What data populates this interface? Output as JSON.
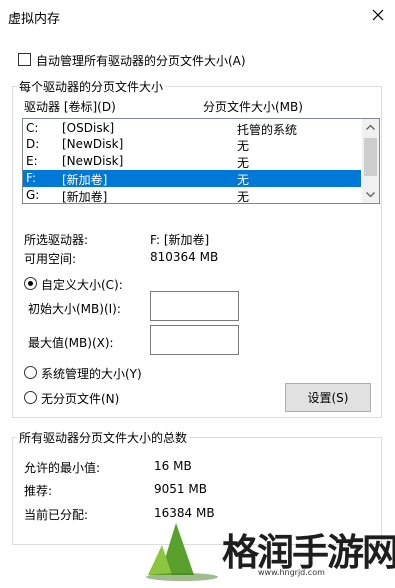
{
  "window": {
    "title": "虚拟内存"
  },
  "auto_manage": {
    "label": "自动管理所有驱动器的分页文件大小(A)",
    "checked": false
  },
  "per_drive": {
    "group_title": "每个驱动器的分页文件大小",
    "col_drive": "驱动器 [卷标](D)",
    "col_size": "分页文件大小(MB)",
    "drives": [
      {
        "letter": "C:",
        "label": "[OSDisk]",
        "size": "托管的系统",
        "selected": false
      },
      {
        "letter": "D:",
        "label": "[NewDisk]",
        "size": "无",
        "selected": false
      },
      {
        "letter": "E:",
        "label": "[NewDisk]",
        "size": "无",
        "selected": false
      },
      {
        "letter": "F:",
        "label": "[新加卷]",
        "size": "无",
        "selected": true
      },
      {
        "letter": "G:",
        "label": "[新加卷]",
        "size": "无",
        "selected": false
      }
    ],
    "selected_drive_label": "所选驱动器:",
    "selected_drive_value": "F:  [新加卷]",
    "free_space_label": "可用空间:",
    "free_space_value": "810364 MB",
    "custom_size_label": "自定义大小(C):",
    "initial_size_label": "初始大小(MB)(I):",
    "initial_size_value": "",
    "max_size_label": "最大值(MB)(X):",
    "max_size_value": "",
    "system_managed_label": "系统管理的大小(Y)",
    "no_paging_label": "无分页文件(N)",
    "selected_option": "custom",
    "set_button": "设置(S)"
  },
  "totals": {
    "group_title": "所有驱动器分页文件大小的总数",
    "min_label": "允许的最小值:",
    "min_value": "16 MB",
    "recommended_label": "推荐:",
    "recommended_value": "9051 MB",
    "current_label": "当前已分配:",
    "current_value": "16384 MB"
  },
  "watermark": {
    "text": "格润手游网",
    "url": "www.hngrjd.com"
  },
  "colors": {
    "selection": "#0078d7",
    "logo_green": "#5aa02c"
  }
}
